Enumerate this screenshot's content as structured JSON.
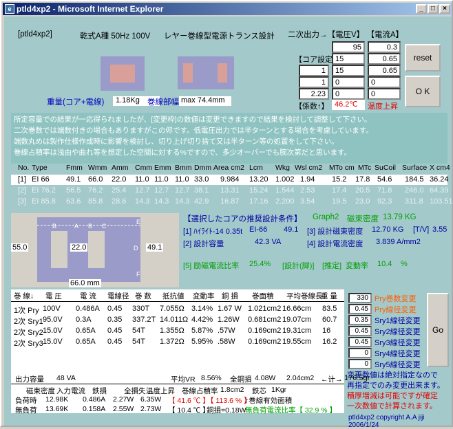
{
  "window": {
    "title": "ptld4xp2 - Microsoft Internet Explorer",
    "min": "_",
    "max": "□",
    "close": "×"
  },
  "header": {
    "tag": "[ptld4xp2]",
    "spec": "乾式A種 50Hz 100V",
    "desc": "レヤー巻線型電源トランス設計",
    "outputs": "二次出力→【電圧V】 【電流A】"
  },
  "inputs": {
    "r1": {
      "v": "95",
      "a": "0.3"
    },
    "r2": {
      "label": "【コア設定】",
      "v": "15",
      "a": "0.65"
    },
    "r3": {
      "left": "1",
      "v": "15",
      "a": "0.65"
    },
    "r4": {
      "left": "1",
      "v": "0",
      "a": "0"
    },
    "r5": {
      "left": "2.23",
      "v": "0",
      "a": "0"
    }
  },
  "buttons": {
    "reset": "reset",
    "ok": "O K",
    "go": "Go"
  },
  "coef": {
    "label": "【係数↑】",
    "temp": "46.2℃",
    "warn": "温度上昇"
  },
  "weight": {
    "label": "重量(コア+電線)",
    "value": "1.18Kg",
    "width_label": "巻線部幅",
    "width_value": "max 74.4mm"
  },
  "notes": [
    "所定容量での結果が一応得られましたが、[変更枠]の数値は変更できますので結果を検討して調整して下さい。",
    "二次巻数では端数付きの場合もありますがこの侭です。低電圧出力では半ターンとする場合を考慮しています。",
    "端数丸めは製作仕様作成時に影響を検討し、切り上げ切り捨て又は半ターン等の処置をして下さい。",
    "巻線占積率は浅由や曲れ等を想定した空間に対する%ですので、多少オーバーでも腕次第だと思います。"
  ],
  "table": {
    "headers": [
      "No.",
      "Type",
      "Fmm",
      "Wmm",
      "Amm",
      "Cmm",
      "Emm",
      "Bmm",
      "Dmm",
      "Area cm2",
      "Lcm",
      "Wkg",
      "Wsl cm2",
      "MTo cm",
      "MTc",
      "SuCoil",
      "Surface",
      "X cm4"
    ],
    "rows": [
      [
        "[1]",
        "EI 66",
        "49.1",
        "66.0",
        "22.0",
        "11.0",
        "11.0",
        "11.0",
        "33.0",
        "9.984",
        "13.20",
        "1.002",
        "1.94",
        "15.2",
        "17.8",
        "54.6",
        "184.5",
        "36.24"
      ],
      [
        "[2]",
        "EI 76.2",
        "56.5",
        "76.2",
        "25.4",
        "12.7",
        "12.7",
        "12.7",
        "38.1",
        "13.31",
        "15.24",
        "1.544",
        "2.53",
        "17.4",
        "20.5",
        "71.8",
        "246.0",
        "64.39"
      ],
      [
        "[3]",
        "EI 85.8",
        "63.6",
        "85.8",
        "28.6",
        "14.3",
        "14.3",
        "14.3",
        "42.9",
        "16.87",
        "17.16",
        "2.200",
        "3.54",
        "19.5",
        "23.0",
        "92.3",
        "311.8",
        "103.51"
      ]
    ]
  },
  "core": {
    "dimA": "55.0",
    "dimB": "22.0",
    "dimC": "49.1",
    "dimW": "66.0 mm",
    "labels": [
      "B",
      "A",
      "B",
      "C",
      "E",
      "D",
      "F"
    ]
  },
  "selected": {
    "title": "【選択したコアの推奨設計条件】",
    "graph": "Graph2",
    "flux_label": "磁束密度",
    "flux": "13.79 KG",
    "l1a": "[1] ﾊｲﾗｲﾄ-14 0.35t",
    "l1b": "EI-66",
    "l1c": "49.1",
    "l1d": "[3] 設計磁束密度",
    "l1e": "12.70 KG",
    "l1f": "[T/V]",
    "l1g": "3.55",
    "l2a": "[2] 設計容量",
    "l2b": "42.3 VA",
    "l2c": "[4] 設計電流密度",
    "l2d": "3.839 A/mm2",
    "l3a": "[5] 励磁電流比率",
    "l3b": "25.4%",
    "l3c": "[設計(脚)]",
    "l3d": "[推定]",
    "l3e": "変動率",
    "l3f": "10.4",
    "l3g": "%"
  },
  "winding": {
    "headers": [
      "巻 線↓",
      "電 圧",
      "電 流",
      "電線径",
      "巻 数",
      "抵抗値",
      "変動率",
      "銅 損",
      "巻面積",
      "平均巻線長",
      "重 量"
    ],
    "rows": [
      [
        "1次 Pry",
        "100V",
        "0.486A",
        "0.45",
        "330T",
        "7.055Ω",
        "3.14%",
        "1.67 W",
        "1.021cm2",
        "16.66cm",
        "83.5"
      ],
      [
        "2次 Sry1",
        "95.0V",
        "0.3A",
        "0.35",
        "337.2T",
        "14.011Ω",
        "4.42%",
        "1.26W",
        "0.681cm2",
        "19.07cm",
        "60.7"
      ],
      [
        "2次 Sry2",
        "15.0V",
        "0.65A",
        "0.45",
        "54T",
        "1.355Ω",
        "5.87%",
        ".57W",
        "0.169cm2",
        "19.31cm",
        "16"
      ],
      [
        "2次 Sry3",
        "15.0V",
        "0.65A",
        "0.45",
        "54T",
        "1.372Ω",
        "5.95%",
        ".58W",
        "0.169cm2",
        "19.55cm",
        "16.2"
      ]
    ]
  },
  "side": {
    "vals": [
      "330",
      "0.45",
      "0.35",
      "0.45",
      "0.45",
      "0",
      "0"
    ],
    "labels": [
      "Pry巻数変更",
      "Pry線径変更",
      "Sry1線径変更",
      "Sry2線径変更",
      "Sry3線径変更",
      "Sry4線径変更",
      "Sry5線径変更"
    ],
    "note1": "変更数値は絶対指定なので",
    "note2": "再指定でのみ変更出来ます。",
    "note3": "積厚増減は可能ですが確定",
    "note4": "一次数値で計算されます。"
  },
  "summary": {
    "out_label": "出力容量",
    "out_val": "48 VA",
    "avr_label": "平均VR",
    "avr": "8.56%",
    "cu_label": "全銅損",
    "cu": "4.08W",
    "area": "2.04cm2",
    "arrow": "←计→",
    "total": "176.5gr",
    "h": [
      "磁束密度",
      "入力電流",
      "鉄損",
      "全損失",
      "温度上昇",
      "巻線占積率",
      "1.8cm2",
      "鉄芯",
      "1Kgr"
    ],
    "load": [
      "負荷時",
      "12.98K",
      "0.486A",
      "2.27W",
      "6.35W",
      "【 41.6 ℃ 】",
      "【 113.6 % 】",
      "↑巻線有効面積"
    ],
    "noload": [
      "無負荷",
      "13.69K",
      "0.158A",
      "2.55W",
      "2.73W",
      "【 10.4 ℃ 】",
      "銅損=0.18W",
      "無負荷電流比率【 32.9 % 】"
    ]
  },
  "copyright": "ptld4xp2 copyright A.A jiji 2006/1/24"
}
